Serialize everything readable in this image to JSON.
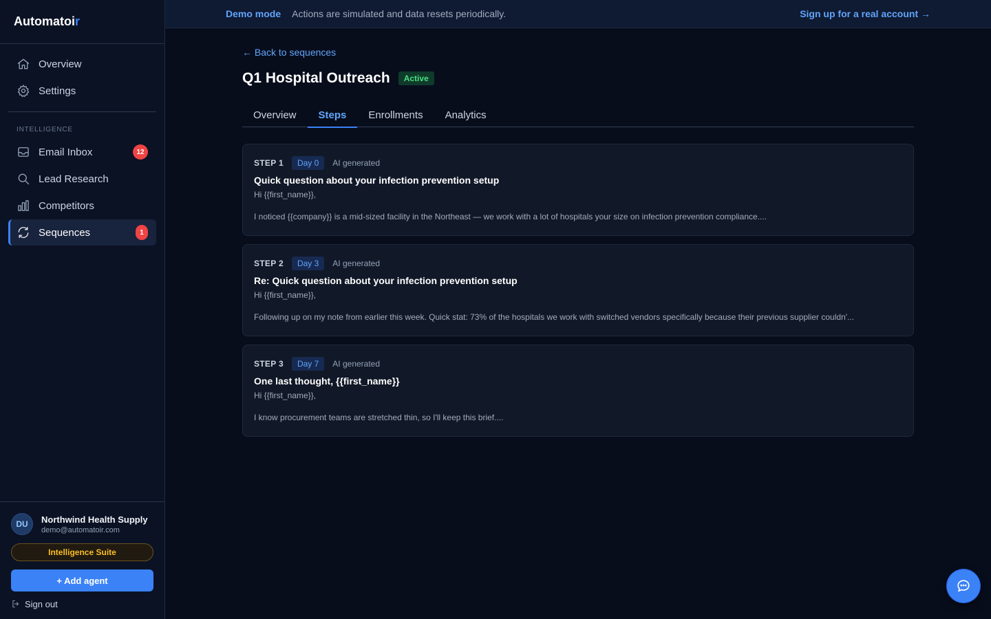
{
  "brand": {
    "name_main": "Automatoi",
    "name_accent": "r"
  },
  "sidebar": {
    "nav": [
      {
        "label": "Overview",
        "icon": "home-icon"
      },
      {
        "label": "Settings",
        "icon": "gear-icon"
      }
    ],
    "section_label": "INTELLIGENCE",
    "intel": [
      {
        "label": "Email Inbox",
        "icon": "inbox-icon",
        "badge": "12"
      },
      {
        "label": "Lead Research",
        "icon": "search-icon"
      },
      {
        "label": "Competitors",
        "icon": "bar-chart-icon"
      },
      {
        "label": "Sequences",
        "icon": "refresh-icon",
        "badge": "1",
        "active": true
      }
    ],
    "user": {
      "initials": "DU",
      "name": "Northwind Health Supply",
      "email": "demo@automatoir.com"
    },
    "plan": "Intelligence Suite",
    "add_agent": "+ Add agent",
    "sign_out": "Sign out"
  },
  "banner": {
    "mode": "Demo mode",
    "message": "Actions are simulated and data resets periodically.",
    "signup": "Sign up for a real account →"
  },
  "main": {
    "back_link": "← Back to sequences",
    "title": "Q1 Hospital Outreach",
    "status": "Active",
    "tabs": [
      {
        "label": "Overview"
      },
      {
        "label": "Steps",
        "active": true
      },
      {
        "label": "Enrollments"
      },
      {
        "label": "Analytics"
      }
    ],
    "steps": [
      {
        "label": "STEP 1",
        "day": "Day 0",
        "tag": "AI generated",
        "subject": "Quick question about your infection prevention setup",
        "greeting": "Hi {{first_name}},",
        "body": "I noticed {{company}} is a mid-sized facility in the Northeast — we work with a lot of hospitals your size on infection prevention compliance...."
      },
      {
        "label": "STEP 2",
        "day": "Day 3",
        "tag": "AI generated",
        "subject": "Re: Quick question about your infection prevention setup",
        "greeting": "Hi {{first_name}},",
        "body": "Following up on my note from earlier this week. Quick stat: 73% of the hospitals we work with switched vendors specifically because their previous supplier couldn'..."
      },
      {
        "label": "STEP 3",
        "day": "Day 7",
        "tag": "AI generated",
        "subject": "One last thought, {{first_name}}",
        "greeting": "Hi {{first_name}},",
        "body": "I know procurement teams are stretched thin, so I'll keep this brief...."
      }
    ]
  },
  "chat": {
    "icon": "chat-bubble-icon"
  },
  "colors": {
    "accent": "#3b82f6",
    "badge": "#ef4444",
    "active_status": "#4ade80",
    "plan": "#fbbf24"
  }
}
